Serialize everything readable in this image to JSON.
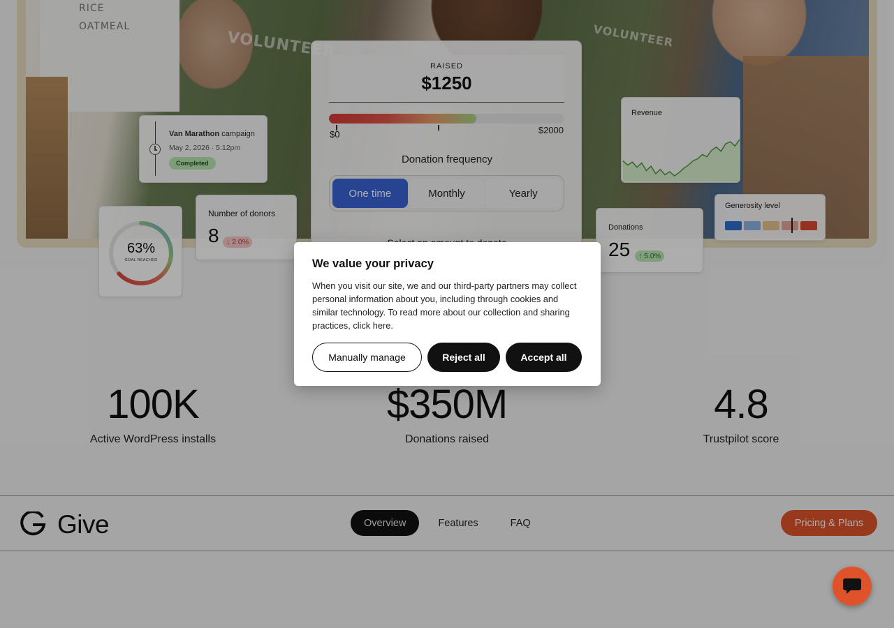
{
  "hero": {
    "board_items": [
      "RICE",
      "OATMEAL"
    ],
    "shirt_text": "VOLUNTEER"
  },
  "campaign_card": {
    "name": "Van Marathon",
    "suffix": " campaign",
    "date": "May 2, 2026 · 5:12pm",
    "status": "Completed",
    "icon": "clock-icon"
  },
  "donors_card": {
    "label": "Number of donors",
    "value": "8",
    "change": "↓ 2.0%"
  },
  "goal_card": {
    "percent": "63%",
    "caption": "GOAL REACHED",
    "progress": 0.63
  },
  "donation_widget": {
    "raised_label": "RAISED",
    "raised_amount": "$1250",
    "min_label": "$0",
    "max_label": "$2000",
    "progress": 0.625,
    "frequency_label": "Donation frequency",
    "frequency_options": [
      "One time",
      "Monthly",
      "Yearly"
    ],
    "frequency_selected": "One time",
    "select_amount_label": "Select an amount to donate"
  },
  "revenue_card": {
    "label": "Revenue",
    "trend": [
      30,
      22,
      28,
      18,
      26,
      12,
      20,
      6,
      14,
      4,
      10,
      2,
      8,
      16,
      22,
      30,
      34,
      42,
      38,
      50,
      56,
      48,
      62,
      66,
      58,
      70
    ]
  },
  "generosity_card": {
    "label": "Generosity level",
    "colors": [
      "#2f6fcf",
      "#8fb4e6",
      "#e6c48e",
      "#e8a59a",
      "#dc4a32"
    ],
    "level": 0.72
  },
  "donations_card": {
    "label": "Donations",
    "value": "25",
    "change": "↑ 5.0%"
  },
  "stats": [
    {
      "value": "100K",
      "caption": "Active WordPress installs"
    },
    {
      "value": "$350M",
      "caption": "Donations raised"
    },
    {
      "value": "4.8",
      "caption": "Trustpilot score"
    }
  ],
  "nav": {
    "logo_text": "Give",
    "links": [
      "Overview",
      "Features",
      "FAQ"
    ],
    "active": "Overview",
    "cta": "Pricing & Plans"
  },
  "chat": {
    "icon": "chat-bubble-icon"
  },
  "consent": {
    "title": "We value your privacy",
    "body": "When you visit our site, we and our third-party partners may collect personal information about you, including through cookies and similar technology. To read more about our collection and sharing practices, click here.",
    "manage_label": "Manually manage",
    "reject_label": "Reject all",
    "accept_label": "Accept all"
  },
  "colors": {
    "accent": "#e0532a",
    "selected": "#3a65d8",
    "dark": "#111111"
  }
}
